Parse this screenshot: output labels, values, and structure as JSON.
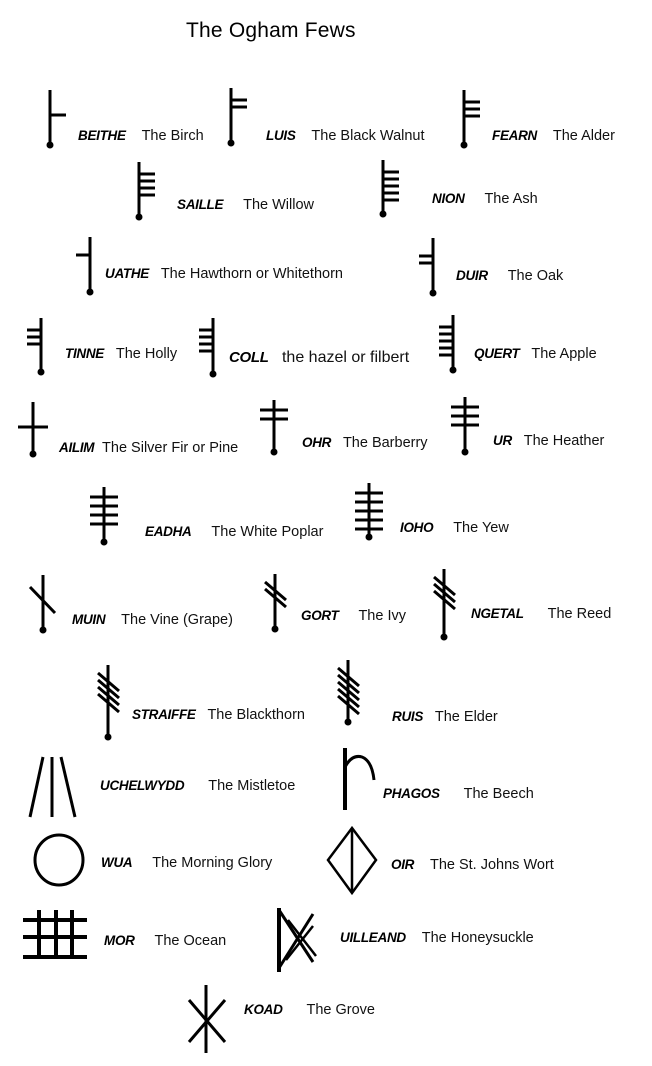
{
  "title": "The Ogham Fews",
  "ink_color": "#000000",
  "background_color": "#ffffff",
  "fews": [
    {
      "id": "beithe",
      "name": "BEITHE",
      "meaning": "The Birch",
      "glyph": {
        "type": "right-strokes",
        "count": 1
      }
    },
    {
      "id": "luis",
      "name": "LUIS",
      "meaning": "The Black Walnut",
      "glyph": {
        "type": "right-strokes",
        "count": 2
      }
    },
    {
      "id": "fearn",
      "name": "FEARN",
      "meaning": "The Alder",
      "glyph": {
        "type": "right-strokes",
        "count": 3
      }
    },
    {
      "id": "saille",
      "name": "SAILLE",
      "meaning": "The Willow",
      "glyph": {
        "type": "right-strokes",
        "count": 4
      }
    },
    {
      "id": "nion",
      "name": "NION",
      "meaning": "The Ash",
      "glyph": {
        "type": "right-strokes",
        "count": 5
      }
    },
    {
      "id": "uathe",
      "name": "UATHE",
      "meaning": "The Hawthorn or Whitethorn",
      "glyph": {
        "type": "left-strokes",
        "count": 1
      }
    },
    {
      "id": "duir",
      "name": "DUIR",
      "meaning": "The Oak",
      "glyph": {
        "type": "left-strokes",
        "count": 2
      }
    },
    {
      "id": "tinne",
      "name": "TINNE",
      "meaning": "The Holly",
      "glyph": {
        "type": "left-strokes",
        "count": 3
      }
    },
    {
      "id": "coll",
      "name": "COLL",
      "meaning": "the hazel or filbert",
      "glyph": {
        "type": "left-strokes",
        "count": 4
      }
    },
    {
      "id": "quert",
      "name": "QUERT",
      "meaning": "The Apple",
      "glyph": {
        "type": "left-strokes",
        "count": 5
      }
    },
    {
      "id": "ailim",
      "name": "AILIM",
      "meaning": "The Silver Fir or Pine",
      "glyph": {
        "type": "cross-strokes",
        "count": 1
      }
    },
    {
      "id": "ohr",
      "name": "OHR",
      "meaning": "The Barberry",
      "glyph": {
        "type": "cross-strokes",
        "count": 2
      }
    },
    {
      "id": "ur",
      "name": "UR",
      "meaning": "The Heather",
      "glyph": {
        "type": "cross-strokes",
        "count": 3
      }
    },
    {
      "id": "eadha",
      "name": "EADHA",
      "meaning": "The White Poplar",
      "glyph": {
        "type": "cross-strokes",
        "count": 4
      }
    },
    {
      "id": "ioho",
      "name": "IOHO",
      "meaning": "The Yew",
      "glyph": {
        "type": "cross-strokes",
        "count": 5
      }
    },
    {
      "id": "muin",
      "name": "MUIN",
      "meaning": "The Vine (Grape)",
      "glyph": {
        "type": "diagonal-strokes",
        "count": 1
      }
    },
    {
      "id": "gort",
      "name": "GORT",
      "meaning": "The Ivy",
      "glyph": {
        "type": "diagonal-strokes",
        "count": 2
      }
    },
    {
      "id": "ngetal",
      "name": "NGETAL",
      "meaning": "The Reed",
      "glyph": {
        "type": "diagonal-strokes",
        "count": 3
      }
    },
    {
      "id": "straiffe",
      "name": "STRAIFFE",
      "meaning": "The Blackthorn",
      "glyph": {
        "type": "diagonal-strokes",
        "count": 4
      }
    },
    {
      "id": "ruis",
      "name": "RUIS",
      "meaning": "The Elder",
      "glyph": {
        "type": "diagonal-strokes",
        "count": 5
      }
    },
    {
      "id": "uchelwydd",
      "name": "UCHELWYDD",
      "meaning": "The Mistletoe",
      "glyph": {
        "type": "three-lines",
        "count": 3
      }
    },
    {
      "id": "phagos",
      "name": "PHAGOS",
      "meaning": "The Beech",
      "glyph": {
        "type": "hook",
        "count": 1
      }
    },
    {
      "id": "wua",
      "name": "WUA",
      "meaning": "The Morning Glory",
      "glyph": {
        "type": "circle",
        "count": 1
      }
    },
    {
      "id": "oir",
      "name": "OIR",
      "meaning": "The St. Johns Wort",
      "glyph": {
        "type": "diamond",
        "count": 1
      }
    },
    {
      "id": "mor",
      "name": "MOR",
      "meaning": "The Ocean",
      "glyph": {
        "type": "grid",
        "count": 3
      }
    },
    {
      "id": "uilleand",
      "name": "UILLEAND",
      "meaning": "The Honeysuckle",
      "glyph": {
        "type": "honeysuckle",
        "count": 1
      }
    },
    {
      "id": "koad",
      "name": "KOAD",
      "meaning": "The Grove",
      "glyph": {
        "type": "star",
        "count": 1
      }
    }
  ]
}
